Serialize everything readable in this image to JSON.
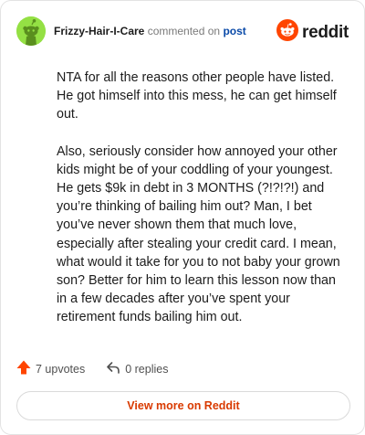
{
  "header": {
    "username": "Frizzy-Hair-I-Care",
    "action_text": "commented on",
    "post_link": "post",
    "brand": "reddit"
  },
  "comment": {
    "paragraphs": [
      "NTA for all the reasons other people have listed. He got himself into this mess, he can get himself out.",
      "Also, seriously consider how annoyed your other kids might be of your coddling of your youngest. He gets $9k in debt in 3 MONTHS (?!?!?!) and you’re thinking of bailing him out? Man, I bet you’ve never shown them that much love, especially after stealing your credit card. I mean, what would it take for you to not baby your grown son? Better for him to learn this lesson now than in a few decades after you’ve spent your retirement funds bailing him out."
    ]
  },
  "footer": {
    "upvotes": "7 upvotes",
    "replies": "0 replies"
  },
  "view_more_label": "View more on Reddit",
  "icons": {
    "avatar": "snoo-avatar-icon",
    "brand_logo": "reddit-logo-icon",
    "upvote": "upvote-arrow-icon",
    "reply": "reply-arrow-icon"
  },
  "colors": {
    "avatar_bg": "#94e044",
    "brand_orange": "#ff4500",
    "upvote": "#ff4500",
    "link_blue": "#0a4aa8",
    "view_more_text": "#d93a00"
  }
}
